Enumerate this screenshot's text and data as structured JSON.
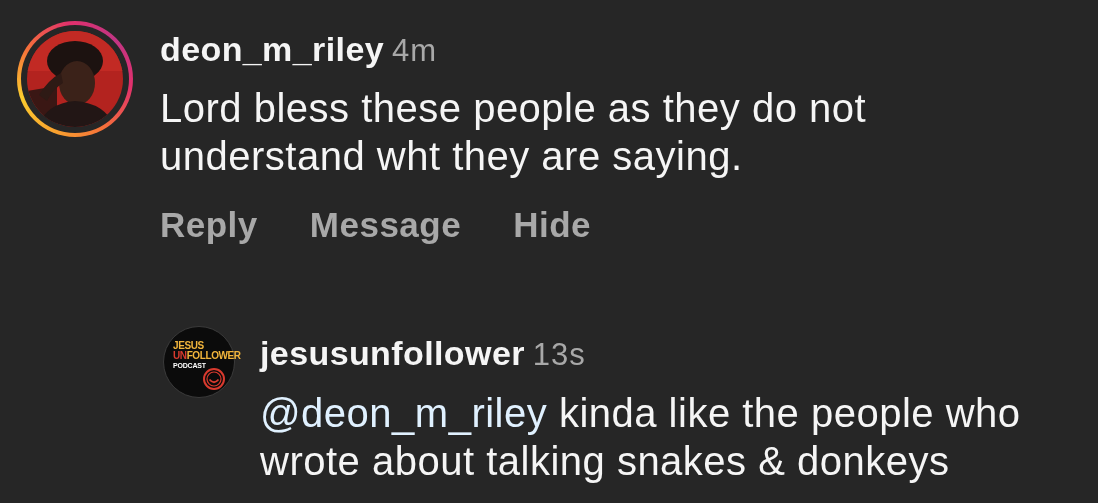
{
  "comments": [
    {
      "username": "deon_m_riley",
      "time": "4m",
      "avatar": {
        "kind": "picture",
        "story_ring": true
      },
      "text": "Lord bless these people as they do not understand wht they are saying.",
      "actions": [
        "Reply",
        "Message",
        "Hide"
      ],
      "replies": [
        {
          "username": "jesusunfollower",
          "time": "13s",
          "avatar": {
            "kind": "logo",
            "story_ring": false,
            "lines": [
              [
                {
                  "text": "JESUS",
                  "color": "#f2b53c"
                }
              ],
              [
                {
                  "text": "UN",
                  "color": "#d83a2e"
                },
                {
                  "text": "FOLLOWER",
                  "color": "#f2b53c"
                }
              ],
              [
                {
                  "text": "PODCAST",
                  "color": "#ffffff"
                }
              ]
            ]
          },
          "mention": "@deon_m_riley",
          "text": "kinda like the people who wrote about talking snakes & donkeys"
        }
      ]
    }
  ]
}
